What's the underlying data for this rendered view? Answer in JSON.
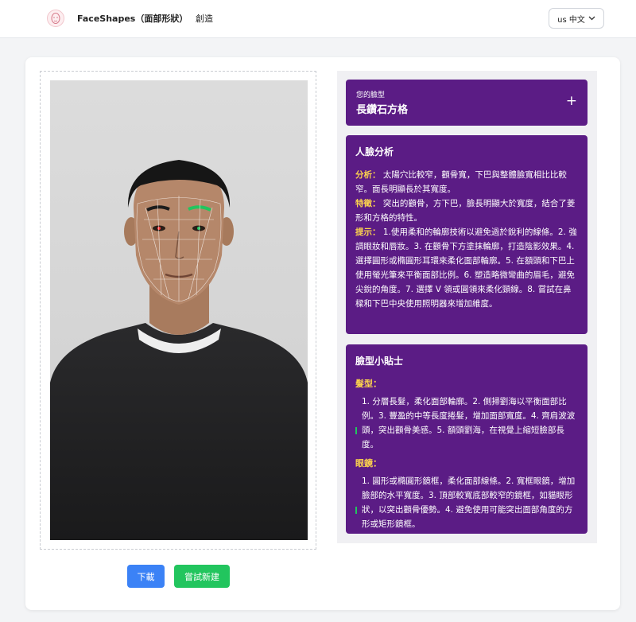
{
  "header": {
    "brand": "FaceShapes（面部形狀）",
    "nav_create": "創造",
    "lang_label": "us 中文"
  },
  "result": {
    "shape_label": "您的臉型",
    "shape_name": "長鑽石方格",
    "expand_symbol": "+"
  },
  "analysis": {
    "title": "人臉分析",
    "analysis_key": "分析：",
    "analysis_text": "太陽穴比較窄，顴骨寬，下巴與整體臉寬相比比較窄。面長明顯長於其寬度。",
    "features_key": "特徵：",
    "features_text": "突出的顴骨，方下巴，臉長明顯大於寬度，結合了菱形和方格的特性。",
    "tips_key": "提示：",
    "tips_text": "1.使用柔和的輪廓技術以避免過於銳利的線條。2. 強調眼妝和唇妝。3. 在顴骨下方塗抹輪廓，打造陰影效果。4. 選擇圓形或橢圓形耳環來柔化面部輪廓。5. 在額頭和下巴上使用螢光筆來平衡面部比例。6. 塑造略微彎曲的眉毛，避免尖銳的角度。7. 選擇 V 領或圓領來柔化頸線。8. 嘗試在鼻樑和下巴中央使用照明器來增加維度。"
  },
  "tips": {
    "title": "臉型小貼士",
    "hair_title": "髮型：",
    "hair_text": "1. 分層長髮，柔化面部輪廓。2. 側掃劉海以平衡面部比例。3. 豐盈的中等長度捲髮，增加面部寬度。4. 齊肩波波頭，突出顴骨美感。5. 額頭劉海，在視覺上縮短臉部長度。",
    "glasses_title": "眼鏡：",
    "glasses_text": "1. 圓形或橢圓形鏡框，柔化面部線條。2. 寬框眼鏡，增加臉部的水平寬度。3. 頂部較寬底部較窄的鏡框，如貓眼形狀，以突出顴骨優勢。4. 避免使用可能突出面部角度的方形或矩形鏡框。"
  },
  "actions": {
    "download": "下載",
    "try_new": "嘗試新建"
  },
  "colors": {
    "panel_purple": "#5b1c85",
    "highlight_yellow": "#fcd34d",
    "download_blue": "#3b82f6",
    "new_green": "#22c55e"
  },
  "icons": {
    "logo": "face-logo-icon",
    "lang_chevron": "chevron-down-icon"
  }
}
